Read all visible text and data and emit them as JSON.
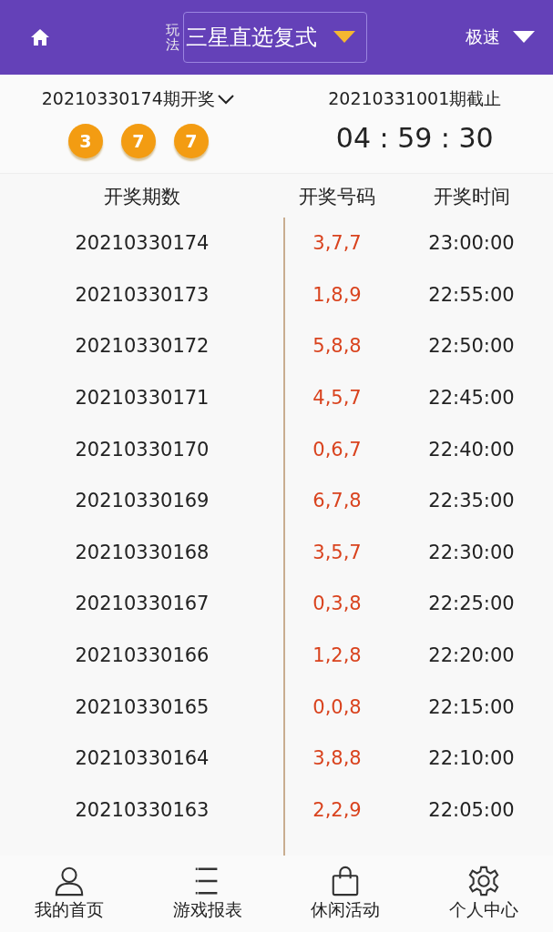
{
  "header": {
    "play_label": "玩法",
    "play_type": "三星直选复式",
    "speed": "极速"
  },
  "last_draw": {
    "title": "20210330174期开奖",
    "balls": [
      "3",
      "7",
      "7"
    ]
  },
  "next_draw": {
    "title": "20210331001期截止",
    "countdown": "04 : 59 : 30"
  },
  "table": {
    "columns": [
      "开奖期数",
      "开奖号码",
      "开奖时间"
    ],
    "rows": [
      {
        "issue": "20210330174",
        "numbers": "3,7,7",
        "time": "23:00:00"
      },
      {
        "issue": "20210330173",
        "numbers": "1,8,9",
        "time": "22:55:00"
      },
      {
        "issue": "20210330172",
        "numbers": "5,8,8",
        "time": "22:50:00"
      },
      {
        "issue": "20210330171",
        "numbers": "4,5,7",
        "time": "22:45:00"
      },
      {
        "issue": "20210330170",
        "numbers": "0,6,7",
        "time": "22:40:00"
      },
      {
        "issue": "20210330169",
        "numbers": "6,7,8",
        "time": "22:35:00"
      },
      {
        "issue": "20210330168",
        "numbers": "3,5,7",
        "time": "22:30:00"
      },
      {
        "issue": "20210330167",
        "numbers": "0,3,8",
        "time": "22:25:00"
      },
      {
        "issue": "20210330166",
        "numbers": "1,2,8",
        "time": "22:20:00"
      },
      {
        "issue": "20210330165",
        "numbers": "0,0,8",
        "time": "22:15:00"
      },
      {
        "issue": "20210330164",
        "numbers": "3,8,8",
        "time": "22:10:00"
      },
      {
        "issue": "20210330163",
        "numbers": "2,2,9",
        "time": "22:05:00"
      }
    ]
  },
  "bottom_nav": [
    {
      "label": "我的首页",
      "kind": "person"
    },
    {
      "label": "游戏报表",
      "kind": "list"
    },
    {
      "label": "休闲活动",
      "kind": "bag"
    },
    {
      "label": "个人中心",
      "kind": "gear"
    }
  ]
}
